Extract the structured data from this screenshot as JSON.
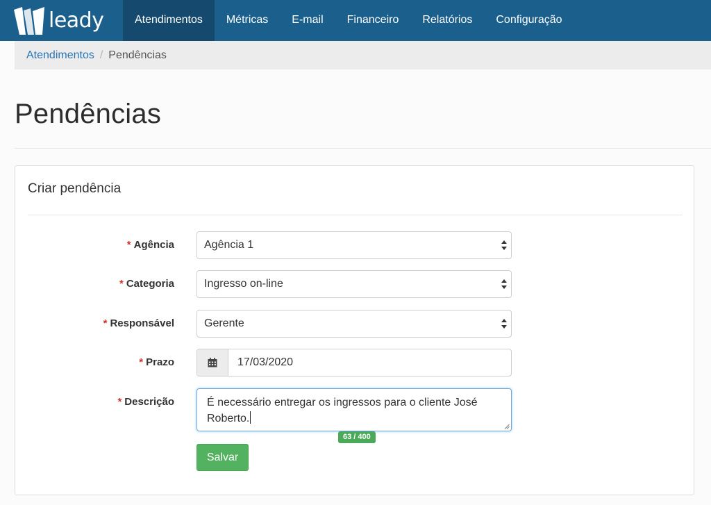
{
  "brand": {
    "name": "leady"
  },
  "nav": {
    "items": [
      {
        "label": "Atendimentos",
        "active": true
      },
      {
        "label": "Métricas"
      },
      {
        "label": "E-mail"
      },
      {
        "label": "Financeiro"
      },
      {
        "label": "Relatórios"
      },
      {
        "label": "Configuração"
      }
    ]
  },
  "breadcrumb": {
    "parent": "Atendimentos",
    "separator": "/",
    "current": "Pendências"
  },
  "page": {
    "title": "Pendências"
  },
  "form": {
    "title": "Criar pendência",
    "required_mark": "*",
    "fields": {
      "agencia": {
        "label": "Agência",
        "value": "Agência 1"
      },
      "categoria": {
        "label": "Categoria",
        "value": "Ingresso on-line"
      },
      "responsavel": {
        "label": "Responsável",
        "value": "Gerente"
      },
      "prazo": {
        "label": "Prazo",
        "value": "17/03/2020",
        "icon": "calendar-icon"
      },
      "descricao": {
        "label": "Descrição",
        "value": "É necessário entregar os ingressos para o cliente José Roberto."
      }
    },
    "char_counter": "63 / 400",
    "save_label": "Salvar"
  },
  "colors": {
    "nav_bg": "#1b5f8c",
    "nav_active": "#154a6e",
    "link": "#2a74b3",
    "required": "#d0312d",
    "button_green": "#53b25f",
    "focus_border": "#6aa6de"
  }
}
